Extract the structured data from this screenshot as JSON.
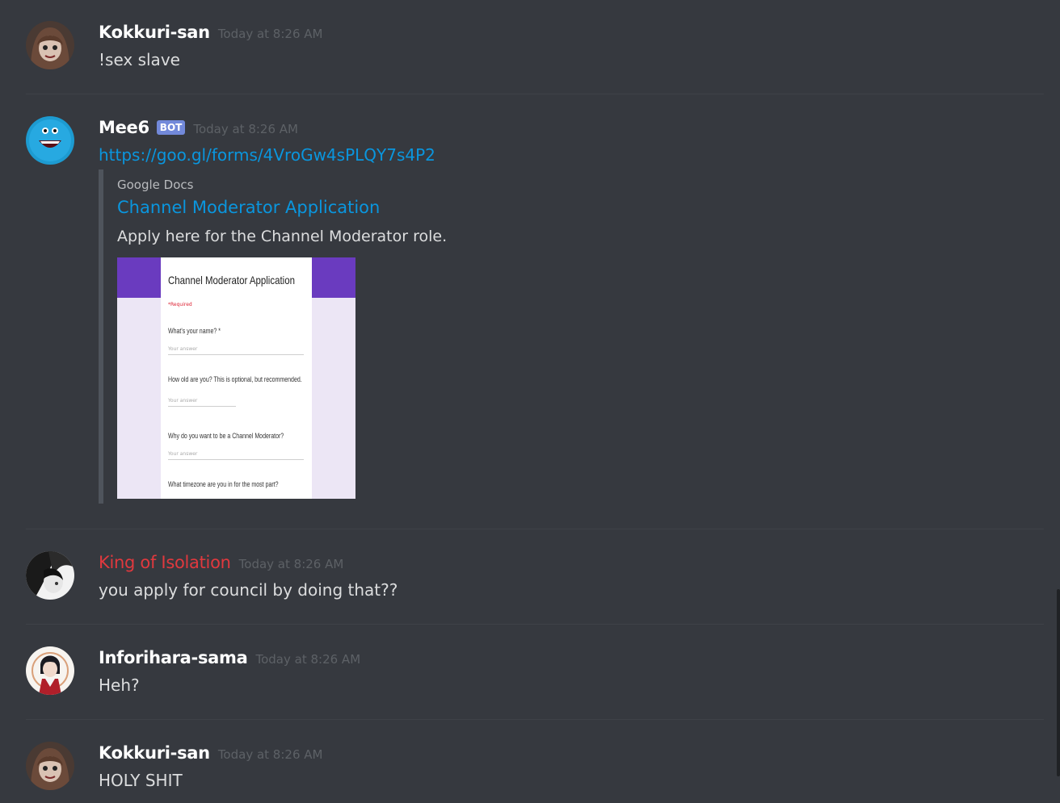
{
  "messages": [
    {
      "username": "Kokkuri-san",
      "timestamp": "Today at 8:26 AM",
      "content": "!sex slave"
    },
    {
      "username": "Mee6",
      "bot_tag": "BOT",
      "timestamp": "Today at 8:26 AM",
      "content": "https://goo.gl/forms/4VroGw4sPLQY7s4P2",
      "embed": {
        "provider": "Google Docs",
        "title": "Channel Moderator Application",
        "description": "Apply here for the Channel Moderator role.",
        "image": {
          "form_title": "Channel Moderator Application",
          "required_note": "*Required",
          "questions": [
            "What's your name? *",
            "How old are you? This is optional, but recommended.",
            "Why do you want to be a Channel Moderator?",
            "What timezone are you in for the most part?"
          ],
          "answer_placeholder": "Your answer"
        }
      }
    },
    {
      "username": "King of Isolation",
      "username_color": "#e0393e",
      "timestamp": "Today at 8:26 AM",
      "content": "you apply for council by doing that??"
    },
    {
      "username": "Inforihara-sama",
      "timestamp": "Today at 8:26 AM",
      "content": "Heh?"
    },
    {
      "username": "Kokkuri-san",
      "timestamp": "Today at 8:26 AM",
      "content": "HOLY SHIT"
    }
  ],
  "colors": {
    "background": "#36393f",
    "link": "#0a96de",
    "bot_tag": "#7289da",
    "embed_border": "#4f545c"
  },
  "icons": [
    "kokkuri-avatar",
    "mee6-avatar",
    "king-of-isolation-avatar",
    "inforihara-avatar"
  ]
}
